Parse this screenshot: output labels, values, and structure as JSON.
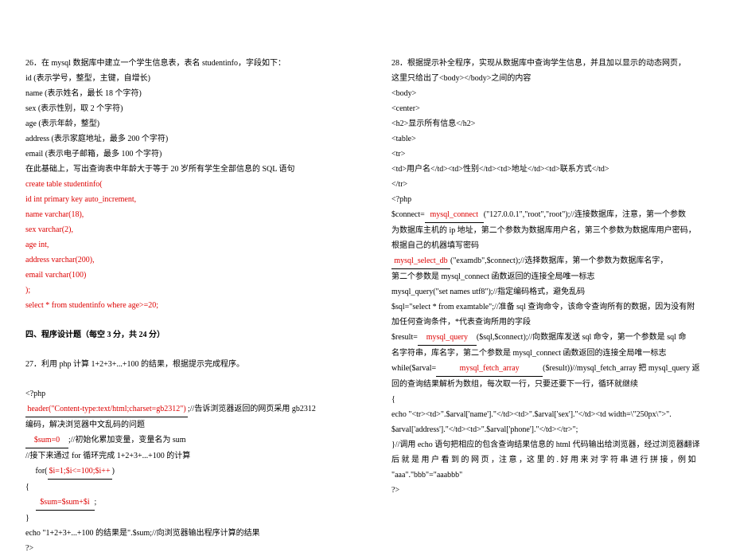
{
  "left": {
    "q26": {
      "line1": "26．在 mysql 数据库中建立一个学生信息表，表名 studentinfo，字段如下：",
      "line2": "id (表示学号，整型，主键，自增长)",
      "line3": "name (表示姓名，最长 18 个字符)",
      "line4": "sex (表示性别，取 2 个字符)",
      "line5": "age (表示年龄，整型)",
      "line6": "address (表示家庭地址，最多 200 个字符)",
      "line7": "email (表示电子邮箱，最多 100 个字符)",
      "line8": "在此基础上，写出查询表中年龄大于等于 20 岁所有学生全部信息的 SQL 语句",
      "ans1": "create table studentinfo(",
      "ans2": "id int primary key auto_increment,",
      "ans3": "name varchar(18),",
      "ans4": "sex varchar(2),",
      "ans5": "age int,",
      "ans6": "address varchar(200),",
      "ans7": "email varchar(100)",
      "ans8": ");",
      "ans9": "select * from studentinfo where age>=20;"
    },
    "section4": "四、程序设计题（每空 3 分，共 24 分）",
    "q27": {
      "line1": "27．利用 php 计算 1+2+3+...+100 的结果，根据提示完成程序。",
      "line2": "<?php",
      "blank1": "header(\"Content-type:text/html;charset=gb2312\")",
      "line3_after": ";//告诉浏览器返回的网页采用 gb2312",
      "line4": "编码，解决浏览器中文乱码的问题",
      "blank2": "$sum=0",
      "line5_after": ";//初始化累加变量，变量名为 sum",
      "line6": "//接下来通过 for 循环完成 1+2+3+...+100 的计算",
      "for_pre": "for(",
      "blank3": "$i=1;$i<=100;$i++",
      "for_post": ")",
      "line8": "{",
      "blank4": "$sum=$sum+$i",
      "line9_after": ";",
      "line10": "}",
      "line11": "echo \"1+2+3+...+100 的结果是\".$sum;//向浏览器输出程序计算的结果",
      "line12": "?>"
    }
  },
  "right": {
    "q28": {
      "line1": "28．根据提示补全程序，实现从数据库中查询学生信息，并且加以显示的动态网页，",
      "line2": "这里只给出了<body></body>之间的内容",
      "line3": "<body>",
      "line4": "<center>",
      "line5": "<h2>显示所有信息</h2>",
      "line6": "<table>",
      "line7": "<tr>",
      "line8": "<td>用户名</td><td>性别</td><td>地址</td><td>联系方式</td>",
      "line9": "</tr>",
      "line10": "<?php",
      "connect_pre": "$connect=",
      "blank1": "mysql_connect",
      "connect_post": "(\"127.0.0.1\",\"root\",\"root\");//连接数据库，注意，第一个参数",
      "line12": "为数据库主机的 ip 地址，第二个参数为数据库用户名，第三个参数为数据库用户密码，",
      "line13": "根据自己的机器填写密码",
      "blank2": "mysql_select_db",
      "selectdb_post": "(\"examdb\",$connect);//选择数据库，第一个参数为数据库名字，",
      "line15": "第二个参数是 mysql_connect 函数返回的连接全局唯一标志",
      "line16": "mysql_query(\"set names utf8\");//指定编码格式，避免乱码",
      "line17": "$sql=\"select * from examtable\";//准备 sql 查询命令，该命令查询所有的数据，因为没有附",
      "line18": "加任何查询条件，*代表查询所用的字段",
      "result_pre": "$result=",
      "blank3": "mysql_query",
      "result_post": "($sql,$connect);//向数据库发送 sql 命令，第一个参数是 sql 命",
      "line20": "名字符串，库名字，第二个参数是 mysql_connect 函数返回的连接全局唯一标志",
      "while_pre": "while($arval=",
      "blank4": "mysql_fetch_array",
      "while_post": "($result))//mysql_fetch_array 把 mysql_query 返",
      "line22": "回的查询结果解析为数组，每次取一行，只要还要下一行，循环就继续",
      "line23": "{",
      "line24": "     echo \"<tr><td>\".$arval['name'].\"</td><td>\".$arval['sex'].\"</td><td width=\\\"250px\\\">\".",
      "line25": "$arval['address'].\"</td><td>\".$arval['phone'].\"</td></tr>\";",
      "line26": "}//调用 echo 语句把相应的包含查询结果信息的 html 代码输出给浏览器，经过浏览器翻译",
      "line27": "后 就 是 用 户 看 到 的 网 页 ，注 意 ，这 里 的 . 好 用 来 对 字 符 串 进 行 拼 接 ，例 如",
      "line28": "\"aaa\".\"bbb\"=\"aaabbb\"",
      "line29": "?>"
    }
  }
}
